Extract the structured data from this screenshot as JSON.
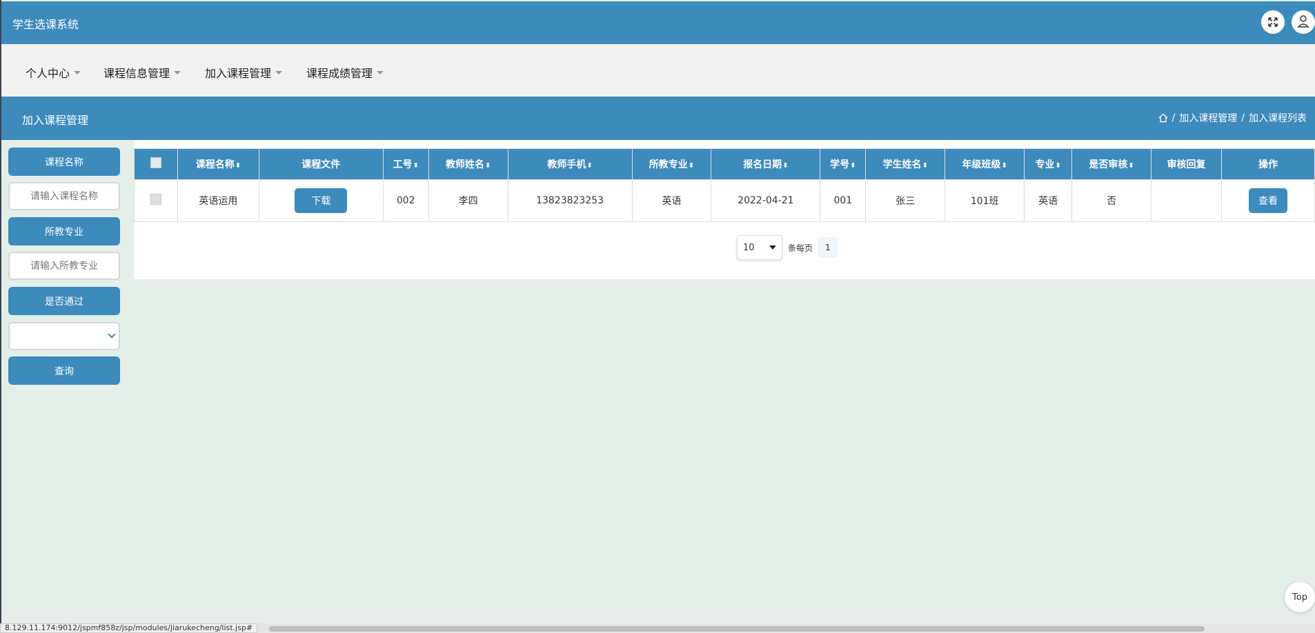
{
  "app": {
    "title": "学生选课系统"
  },
  "nav": {
    "items": [
      {
        "label": "个人中心"
      },
      {
        "label": "课程信息管理"
      },
      {
        "label": "加入课程管理"
      },
      {
        "label": "课程成绩管理"
      }
    ]
  },
  "subheader": {
    "title": "加入课程管理",
    "breadcrumb": [
      "加入课程管理",
      "加入课程列表"
    ],
    "separator": "/"
  },
  "search": {
    "course_name_label": "课程名称",
    "course_name_placeholder": "请输入课程名称",
    "major_label": "所教专业",
    "major_placeholder": "请输入所教专业",
    "passed_label": "是否通过",
    "passed_value": "",
    "query_button": "查询"
  },
  "table": {
    "columns": [
      "课程名称",
      "课程文件",
      "工号",
      "教师姓名",
      "教师手机",
      "所教专业",
      "报名日期",
      "学号",
      "学生姓名",
      "年级班级",
      "专业",
      "是否审核",
      "审核回复",
      "操作"
    ],
    "sortable": [
      true,
      false,
      true,
      true,
      true,
      true,
      true,
      true,
      true,
      true,
      true,
      true,
      false,
      false
    ],
    "sort_glyph": "⬍",
    "rows": [
      {
        "course_name": "英语运用",
        "file_button": "下载",
        "teacher_id": "002",
        "teacher_name": "李四",
        "teacher_phone": "13823823253",
        "major_taught": "英语",
        "signup_date": "2022-04-21",
        "student_id": "001",
        "student_name": "张三",
        "class": "101班",
        "major": "英语",
        "reviewed": "否",
        "review_reply": "",
        "action_button": "查看"
      }
    ]
  },
  "pagination": {
    "page_size": "10",
    "per_page_label": "条每页",
    "current_page": "1"
  },
  "top_button": "Top",
  "status_url": "8.129.11.174:9012/jspmf858z/jsp/modules/jiarukecheng/list.jsp#",
  "colors": {
    "primary": "#3d8abd",
    "nav_bg": "#f2f2f2",
    "page_bg": "#e4efea"
  },
  "icons": {
    "fullscreen": "expand-icon",
    "user": "user-icon",
    "home": "home-icon"
  }
}
